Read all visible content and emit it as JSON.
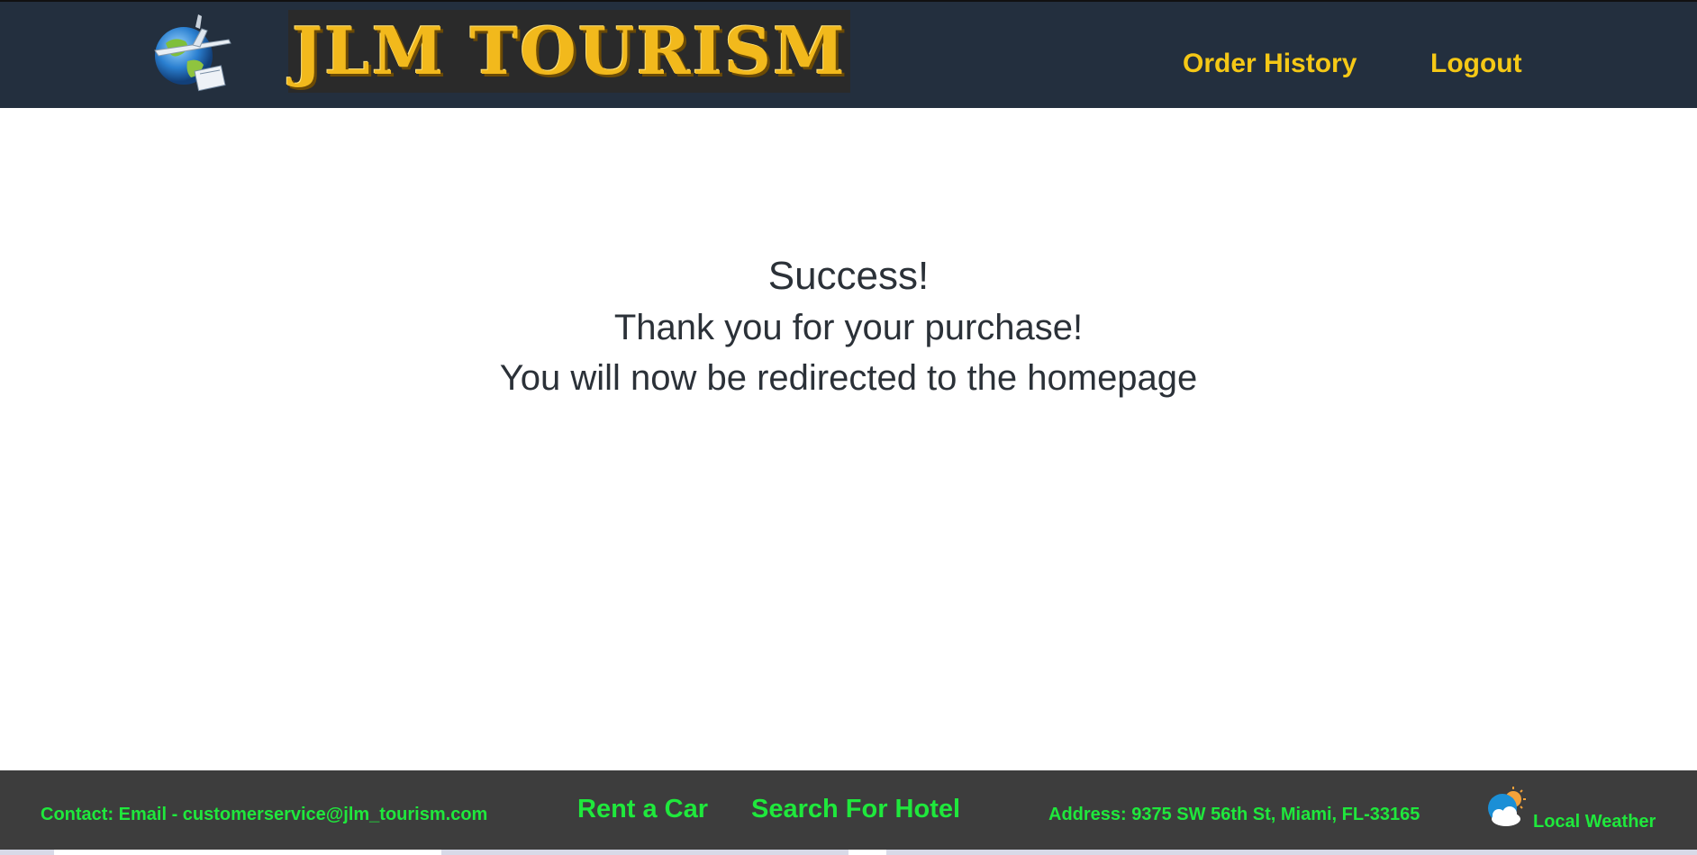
{
  "header": {
    "logo_text": "JLM TOURISM",
    "nav": {
      "order_history": "Order History",
      "logout": "Logout"
    }
  },
  "main": {
    "title": "Success!",
    "line1": "Thank you for your purchase!",
    "line2": "You will now be redirected to the homepage"
  },
  "footer": {
    "contact": "Contact: Email - customerservice@jlm_tourism.com",
    "rent_car": "Rent a Car",
    "search_hotel": "Search For Hotel",
    "address": "Address: 9375 SW 56th St, Miami, FL-33165",
    "local_weather": "Local Weather"
  },
  "colors": {
    "header_bg": "#232f3e",
    "nav_link": "#f5c816",
    "logo_gold": "#f2b91c",
    "footer_bg": "#3d3d3d",
    "footer_text": "#1fe83c",
    "body_text": "#2b3138"
  },
  "icons": {
    "globe": "globe-airplane-icon",
    "weather": "sun-cloud-weather-icon"
  }
}
